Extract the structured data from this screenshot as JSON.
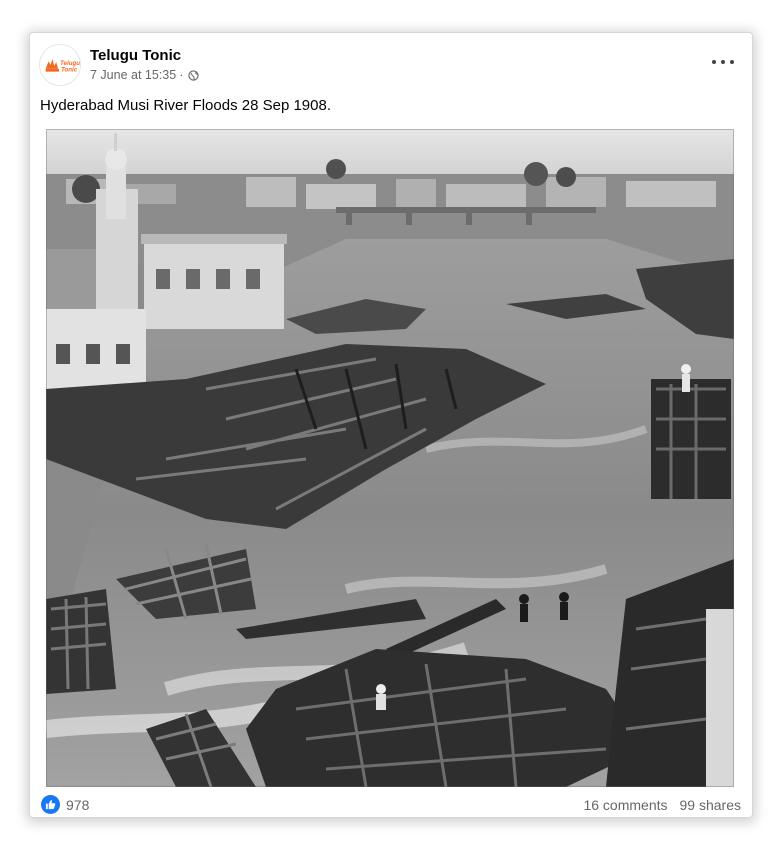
{
  "post": {
    "page_name": "Telugu Tonic",
    "timestamp": "7 June at 15:35",
    "separator": "·",
    "caption": "Hyderabad Musi River Floods 28 Sep 1908.",
    "avatar_logo_text": [
      "Telugu",
      "Tonic"
    ]
  },
  "icons": {
    "privacy": "globe-icon",
    "menu": "more-options-icon",
    "reaction": "like-icon"
  },
  "stats": {
    "likes": "978",
    "comments": "16 comments",
    "shares": "99 shares"
  },
  "colors": {
    "brand_blue": "#1877f2",
    "meta_gray": "#65676b",
    "logo_orange": "#f26a21"
  }
}
